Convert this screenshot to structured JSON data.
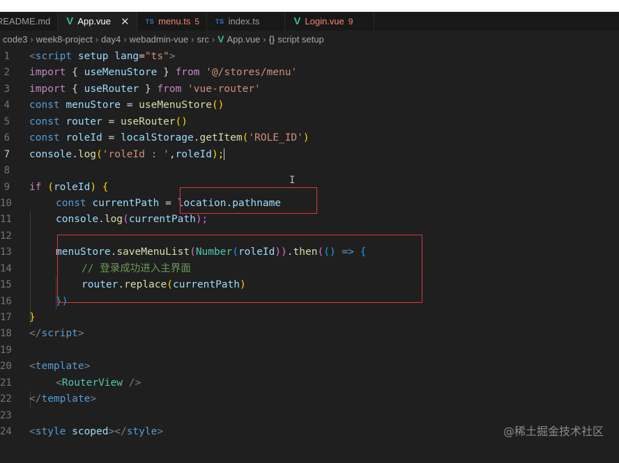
{
  "tabs": [
    {
      "label": "README.md",
      "icon": "markdown-icon",
      "active": false
    },
    {
      "label": "App.vue",
      "icon": "vue-icon",
      "active": true,
      "close": "✕"
    },
    {
      "label": "menu.ts",
      "icon": "ts-icon",
      "badge": "5"
    },
    {
      "label": "index.ts",
      "icon": "ts-icon"
    },
    {
      "label": "Login.vue",
      "icon": "vue-icon",
      "badge": "9"
    }
  ],
  "ts_icon_text": "TS",
  "breadcrumb": [
    "code3",
    "week8-project",
    "day4",
    "webadmin-vue",
    "src",
    "App.vue",
    "script setup"
  ],
  "breadcrumb_symbol": "{}",
  "line_numbers": [
    "1",
    "2",
    "3",
    "4",
    "5",
    "6",
    "7",
    "8",
    "9",
    "10",
    "11",
    "12",
    "13",
    "14",
    "15",
    "16",
    "17",
    "18",
    "19",
    "20",
    "21",
    "22",
    "23",
    "24"
  ],
  "current_line": "7",
  "code": {
    "l1": {
      "a": "<",
      "b": "script",
      "c": " setup",
      "d": " lang",
      "e": "=",
      "f": "\"ts\"",
      "g": ">"
    },
    "l2": {
      "a": "import",
      "b": " { ",
      "c": "useMenuStore",
      "d": " } ",
      "e": "from",
      "f": " '@/stores/menu'"
    },
    "l3": {
      "a": "import",
      "b": " { ",
      "c": "useRouter",
      "d": " } ",
      "e": "from",
      "f": " 'vue-router'"
    },
    "l4": {
      "a": "const",
      "b": " menuStore",
      "c": " = ",
      "d": "useMenuStore",
      "e": "()"
    },
    "l5": {
      "a": "const",
      "b": " router",
      "c": " = ",
      "d": "useRouter",
      "e": "()"
    },
    "l6": {
      "a": "const",
      "b": " roleId",
      "c": " = ",
      "d": "localStorage",
      "e": ".",
      "f": "getItem",
      "g": "(",
      "h": "'ROLE_ID'",
      "i": ")"
    },
    "l7": {
      "a": "console",
      "b": ".",
      "c": "log",
      "d": "(",
      "e": "'roleId : '",
      "f": ",",
      "g": "roleId",
      "h": ");"
    },
    "l9": {
      "a": "if",
      "b": " (",
      "c": "roleId",
      "d": ") ",
      "e": "{"
    },
    "l10": {
      "a": "const",
      "b": " currentPath",
      "c": " = ",
      "d": "location",
      "e": ".",
      "f": "pathname"
    },
    "l11": {
      "a": "console",
      "b": ".",
      "c": "log",
      "d": "(",
      "e": "currentPath",
      "f": ");"
    },
    "l13": {
      "a": "menuStore",
      "b": ".",
      "c": "saveMenuList",
      "d": "(",
      "e": "Number",
      "f": "(",
      "g": "roleId",
      "h": "))",
      "i": ".",
      "j": "then",
      "k": "(",
      "l": "() ",
      "m": "=>",
      "n": " {"
    },
    "l14": {
      "a": "// 登录成功进入主界面"
    },
    "l15": {
      "a": "router",
      "b": ".",
      "c": "replace",
      "d": "(",
      "e": "currentPath",
      "f": ")"
    },
    "l16": {
      "a": "})"
    },
    "l17": {
      "a": "}"
    },
    "l18": {
      "a": "</",
      "b": "script",
      "c": ">"
    },
    "l20": {
      "a": "<",
      "b": "template",
      "c": ">"
    },
    "l21": {
      "a": "<",
      "b": "RouterView",
      "c": " />"
    },
    "l22": {
      "a": "</",
      "b": "template",
      "c": ">"
    },
    "l24": {
      "a": "<",
      "b": "style",
      "c": " scoped",
      "d": "></",
      "e": "style",
      "f": ">"
    }
  },
  "watermark": "@稀土掘金技术社区",
  "colors": {
    "editor_bg": "#1f1f1f",
    "highlight_box": "#e0353a",
    "keyword": "#569cd6",
    "control": "#c586c0",
    "string": "#ce9178",
    "variable": "#9cdcfe",
    "function": "#dcdcaa",
    "comment": "#6a9955"
  }
}
